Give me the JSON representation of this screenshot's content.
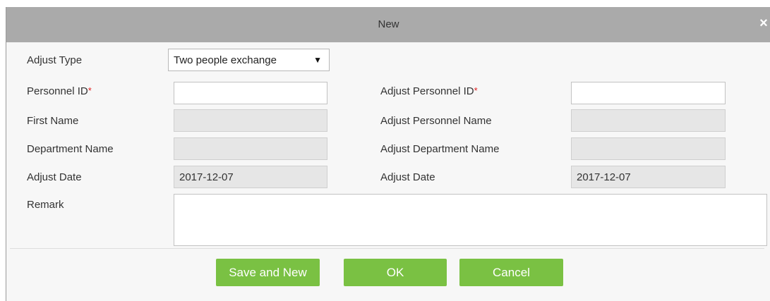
{
  "dialog": {
    "title": "New",
    "close_glyph": "×"
  },
  "form": {
    "adjust_type": {
      "label": "Adjust Type",
      "selected": "Two people exchange",
      "caret_glyph": "▼"
    },
    "personnel_id": {
      "label": "Personnel ID",
      "required_mark": "*",
      "value": ""
    },
    "adjust_personnel_id": {
      "label": "Adjust Personnel ID",
      "required_mark": "*",
      "value": ""
    },
    "first_name": {
      "label": "First Name",
      "value": ""
    },
    "adjust_personnel_name": {
      "label": "Adjust Personnel Name",
      "value": ""
    },
    "department_name": {
      "label": "Department Name",
      "value": ""
    },
    "adjust_department_name": {
      "label": "Adjust Department Name",
      "value": ""
    },
    "adjust_date_left": {
      "label": "Adjust Date",
      "value": "2017-12-07"
    },
    "adjust_date_right": {
      "label": "Adjust Date",
      "value": "2017-12-07"
    },
    "remark": {
      "label": "Remark",
      "value": ""
    }
  },
  "buttons": {
    "save_and_new": "Save and New",
    "ok": "OK",
    "cancel": "Cancel"
  },
  "colors": {
    "titlebar": "#aaaaaa",
    "button": "#7ac143",
    "required": "#e02020",
    "readonly_field": "#e6e6e6"
  },
  "icons": {
    "close": "close-icon",
    "dropdown": "chevron-down-icon"
  }
}
